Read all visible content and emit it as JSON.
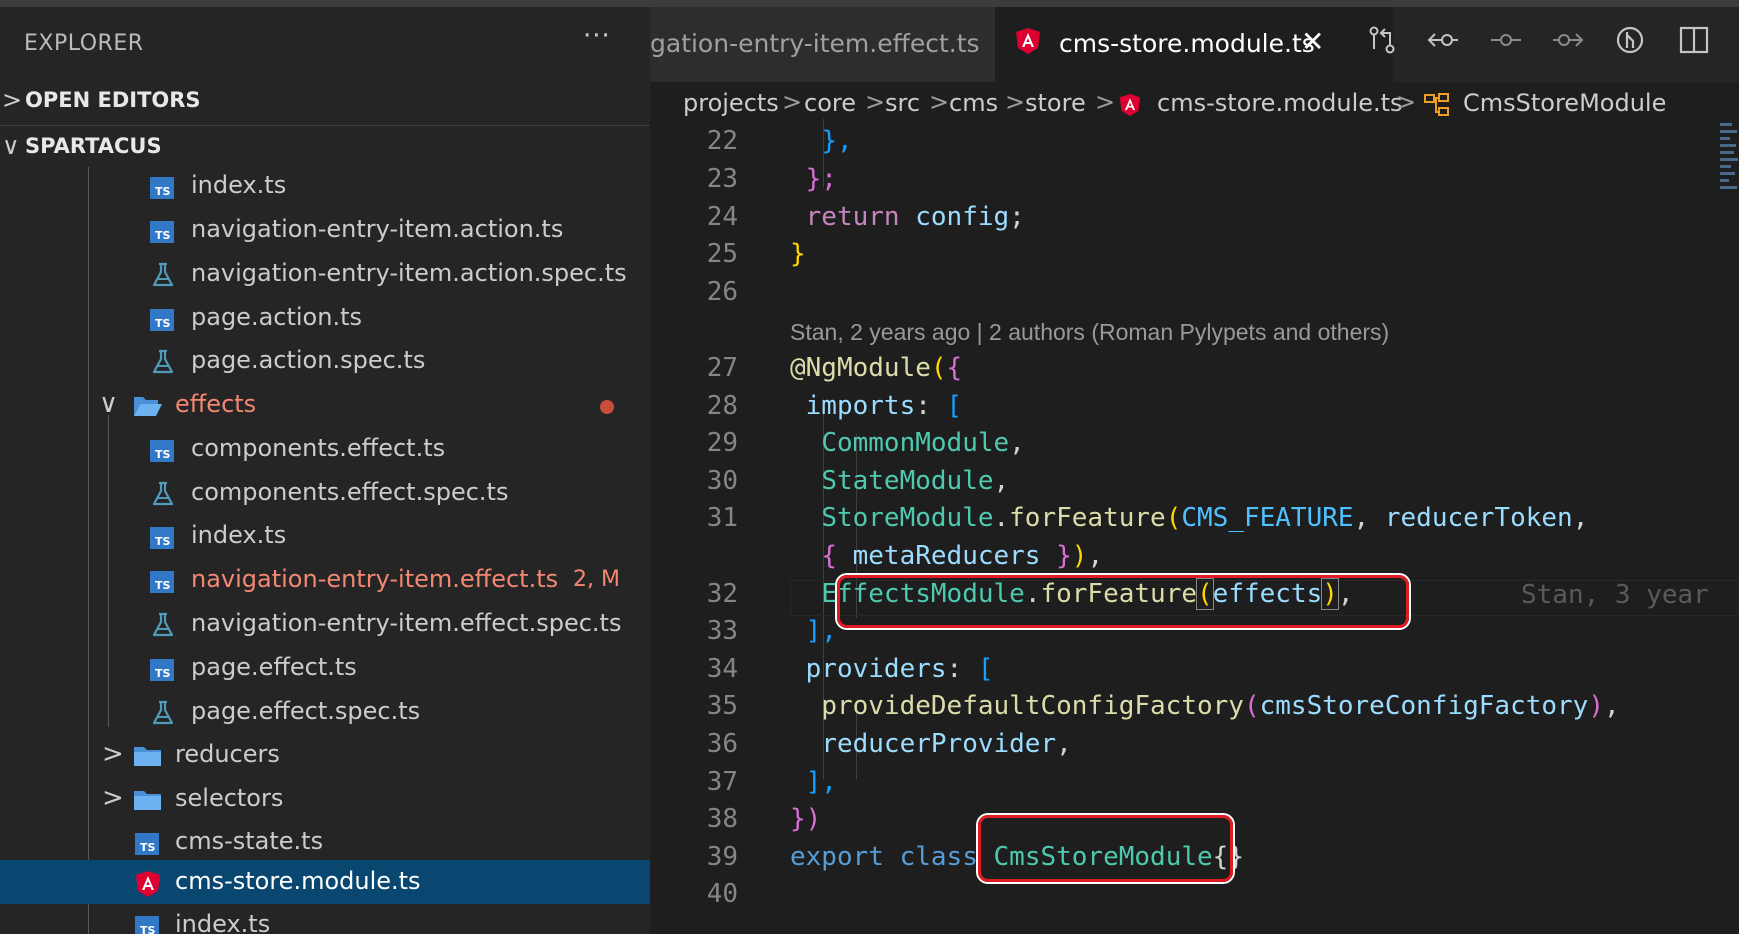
{
  "sidebar": {
    "title": "EXPLORER",
    "more": "···",
    "sections": [
      {
        "label": "OPEN EDITORS",
        "chevron": ">"
      },
      {
        "label": "SPARTACUS",
        "chevron": "∨"
      }
    ],
    "files": [
      {
        "name": "index.ts",
        "icon": "ts-icon"
      },
      {
        "name": "navigation-entry-item.action.ts",
        "icon": "ts-icon"
      },
      {
        "name": "navigation-entry-item.action.spec.ts",
        "icon": "flask-icon"
      },
      {
        "name": "page.action.ts",
        "icon": "ts-icon"
      },
      {
        "name": "page.action.spec.ts",
        "icon": "flask-icon"
      },
      {
        "name": "effects",
        "icon": "folder-open-icon",
        "chevron": "∨"
      },
      {
        "name": "components.effect.ts",
        "icon": "ts-icon"
      },
      {
        "name": "components.effect.spec.ts",
        "icon": "flask-icon"
      },
      {
        "name": "index.ts",
        "icon": "ts-icon"
      },
      {
        "name": "navigation-entry-item.effect.ts",
        "icon": "ts-icon",
        "badge": "2, M"
      },
      {
        "name": "navigation-entry-item.effect.spec.ts",
        "icon": "flask-icon"
      },
      {
        "name": "page.effect.ts",
        "icon": "ts-icon"
      },
      {
        "name": "page.effect.spec.ts",
        "icon": "flask-icon"
      },
      {
        "name": "reducers",
        "icon": "folder-icon",
        "chevron": ">"
      },
      {
        "name": "selectors",
        "icon": "folder-icon",
        "chevron": ">"
      },
      {
        "name": "cms-state.ts",
        "icon": "ts-icon"
      },
      {
        "name": "cms-store.module.ts",
        "icon": "angular-icon"
      },
      {
        "name": "index.ts",
        "icon": "ts-icon"
      }
    ],
    "ts_icon_label": "TS"
  },
  "tabs": [
    {
      "label": "gation-entry-item.effect.ts",
      "active": false
    },
    {
      "label": "cms-store.module.ts",
      "active": true,
      "close": "✕"
    }
  ],
  "breadcrumb": [
    "projects",
    "core",
    "src",
    "cms",
    "store",
    "cms-store.module.ts",
    "CmsStoreModule"
  ],
  "breadcrumb_sep": ">",
  "blame": {
    "codelens": "Stan, 2 years ago | 2 authors (Roman Pylypets and others)",
    "inline": "Stan, 3 year"
  },
  "line_numbers": [
    "22",
    "23",
    "24",
    "25",
    "26",
    "27",
    "28",
    "29",
    "30",
    "31",
    "",
    "32",
    "33",
    "34",
    "35",
    "36",
    "37",
    "38",
    "39",
    "40"
  ],
  "code": {
    "l22a": "},",
    "l23a": "};",
    "l24_kw": "return",
    "l24_var": "config",
    "l24_semi": ";",
    "l25": "}",
    "l27_at": "@",
    "l27_dec": "NgModule",
    "l27_p": "(",
    "l27_b": "{",
    "l28_key": "imports",
    "l28_colon": ": ",
    "l28_br": "[",
    "l29": "CommonModule",
    "l30": "StateModule",
    "l31_mod": "StoreModule",
    "l31_fn": "forFeature",
    "l31_p": "(",
    "l31_const": "CMS_FEATURE",
    "l31_tok": "reducerToken",
    "l31b_ob": "{",
    "l31b_var": "metaReducers",
    "l31b_cb": "}",
    "l31b_cp": ")",
    "l32_mod": "EffectsModule",
    "l32_fn": "forFeature",
    "l32_p": "(",
    "l32_var": "effects",
    "l32_cp": ")",
    "l33": "],",
    "l34_key": "providers",
    "l34_colon": ": ",
    "l34_br": "[",
    "l35_fn": "provideDefaultConfigFactory",
    "l35_p": "(",
    "l35_arg": "cmsStoreConfigFactory",
    "l35_cp": ")",
    "l36": "reducerProvider",
    "l37": "],",
    "l38": "})",
    "l39_kw": "export",
    "l39_kw2": "class",
    "l39_cls": "CmsStoreModule",
    "l39_body": "{}",
    "comma": ",",
    "dot": "."
  },
  "colors": {
    "highlight_box": "#e01b24",
    "modified_file": "#f48771",
    "selection": "#094771"
  }
}
